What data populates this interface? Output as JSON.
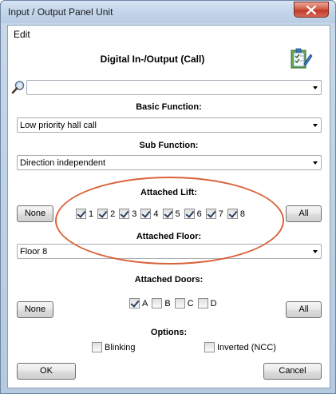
{
  "window": {
    "title": "Input / Output Panel Unit"
  },
  "menu": {
    "edit_label": "Edit"
  },
  "header": {
    "title": "Digital In-/Output (Call)",
    "icon": "checklist-icon"
  },
  "search": {
    "value": ""
  },
  "basic_function": {
    "label": "Basic Function:",
    "value": "Low priority hall call"
  },
  "sub_function": {
    "label": "Sub Function:",
    "value": "Direction independent"
  },
  "attached_lift": {
    "label": "Attached Lift:",
    "none_label": "None",
    "all_label": "All",
    "items": [
      {
        "label": "1",
        "checked": true
      },
      {
        "label": "2",
        "checked": true
      },
      {
        "label": "3",
        "checked": true
      },
      {
        "label": "4",
        "checked": true
      },
      {
        "label": "5",
        "checked": true
      },
      {
        "label": "6",
        "checked": true
      },
      {
        "label": "7",
        "checked": true
      },
      {
        "label": "8",
        "checked": true
      }
    ]
  },
  "attached_floor": {
    "label": "Attached Floor:",
    "value": "Floor 8"
  },
  "attached_doors": {
    "label": "Attached Doors:",
    "none_label": "None",
    "all_label": "All",
    "items": [
      {
        "label": "A",
        "checked": true
      },
      {
        "label": "B",
        "checked": false
      },
      {
        "label": "C",
        "checked": false
      },
      {
        "label": "D",
        "checked": false
      }
    ]
  },
  "options": {
    "label": "Options:",
    "blinking_label": "Blinking",
    "blinking_checked": false,
    "inverted_label": "Inverted (NCC)",
    "inverted_checked": false
  },
  "footer": {
    "ok_label": "OK",
    "cancel_label": "Cancel"
  },
  "colors": {
    "highlight_oval": "#d9623a",
    "title_bar": "#c3d5e9",
    "close_button": "#c0392b"
  }
}
